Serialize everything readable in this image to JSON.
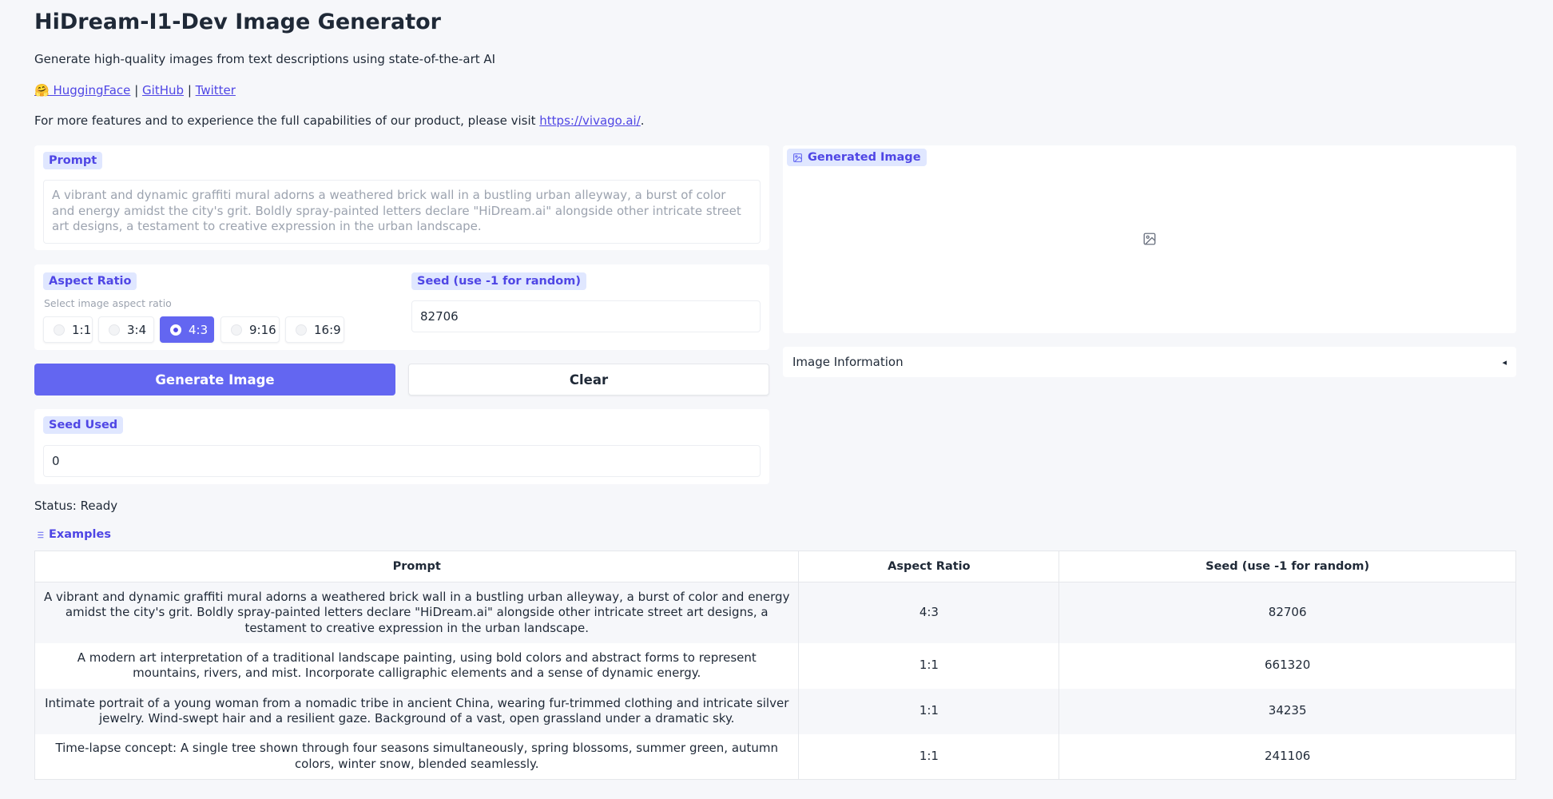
{
  "header": {
    "title": "HiDream-I1-Dev Image Generator",
    "subtitle": "Generate high-quality images from text descriptions using state-of-the-art AI",
    "links": {
      "hf_emoji": "🤗",
      "huggingface": "HuggingFace",
      "github": "GitHub",
      "twitter": "Twitter",
      "sep": "|"
    },
    "visit_text": "For more features and to experience the full capabilities of our product, please visit ",
    "visit_link": "https://vivago.ai/",
    "visit_tail": "."
  },
  "prompt": {
    "label": "Prompt",
    "placeholder": "A vibrant and dynamic graffiti mural adorns a weathered brick wall in a bustling urban alleyway, a burst of color and energy amidst the city's grit. Boldly spray-painted letters declare \"HiDream.ai\" alongside other intricate street art designs, a testament to creative expression in the urban landscape."
  },
  "aspect_ratio": {
    "label": "Aspect Ratio",
    "info": "Select image aspect ratio",
    "options": [
      "1:1",
      "3:4",
      "4:3",
      "9:16",
      "16:9"
    ],
    "selected": "4:3"
  },
  "seed": {
    "label": "Seed (use -1 for random)",
    "value": "82706"
  },
  "buttons": {
    "generate": "Generate Image",
    "clear": "Clear"
  },
  "seed_used": {
    "label": "Seed Used",
    "value": "0"
  },
  "output": {
    "label": "Generated Image",
    "info_accordion": "Image Information",
    "accordion_icon": "◂"
  },
  "status": "Status: Ready",
  "examples": {
    "label": "Examples",
    "headers": [
      "Prompt",
      "Aspect Ratio",
      "Seed (use -1 for random)"
    ],
    "rows": [
      {
        "prompt": "A vibrant and dynamic graffiti mural adorns a weathered brick wall in a bustling urban alleyway, a burst of color and energy amidst the city's grit. Boldly spray-painted letters declare \"HiDream.ai\" alongside other intricate street art designs, a testament to creative expression in the urban landscape.",
        "ratio": "4:3",
        "seed": "82706"
      },
      {
        "prompt": "A modern art interpretation of a traditional landscape painting, using bold colors and abstract forms to represent mountains, rivers, and mist. Incorporate calligraphic elements and a sense of dynamic energy.",
        "ratio": "1:1",
        "seed": "661320"
      },
      {
        "prompt": "Intimate portrait of a young woman from a nomadic tribe in ancient China, wearing fur-trimmed clothing and intricate silver jewelry. Wind-swept hair and a resilient gaze. Background of a vast, open grassland under a dramatic sky.",
        "ratio": "1:1",
        "seed": "34235"
      },
      {
        "prompt": "Time-lapse concept: A single tree shown through four seasons simultaneously, spring blossoms, summer green, autumn colors, winter snow, blended seamlessly.",
        "ratio": "1:1",
        "seed": "241106"
      }
    ]
  },
  "colors": {
    "accent": "#6366f1",
    "chip_bg": "#e0e7ff",
    "chip_text": "#4f46e5",
    "background": "#f6f7fa"
  }
}
